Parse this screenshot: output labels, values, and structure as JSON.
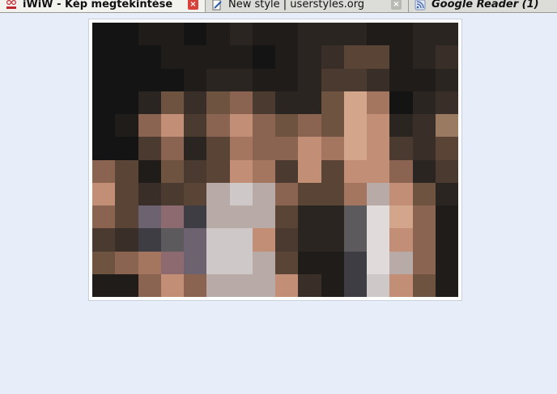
{
  "tabs": [
    {
      "label": "iWiW - Kép megtekintése",
      "icon": "iwiw-logo-icon",
      "active": true
    },
    {
      "label": "New style | userstyles.org",
      "icon": "pencil-page-icon",
      "active": false
    },
    {
      "label": "Google Reader (1)",
      "icon": "rss-feed-icon",
      "active": false
    }
  ],
  "close_symbol": "×",
  "colors": {
    "page_bg": "#e8eef9",
    "close_active": "#d9413b",
    "close_inactive": "#b9b9b4"
  },
  "photo": {
    "palette": [
      "#141414",
      "#1f1c1a",
      "#2b2521",
      "#3a2f28",
      "#4a3a30",
      "#5a4436",
      "#6e5340",
      "#8a6450",
      "#a47660",
      "#c28e76",
      "#d3a58a",
      "#b8aaa6",
      "#cfc8c8",
      "#e0dada",
      "#5d5a5e",
      "#3f3d44",
      "#6d6270",
      "#8c6a70",
      "#241f1f",
      "#9a7a60"
    ],
    "pixels": [
      [
        0,
        0,
        1,
        1,
        0,
        1,
        2,
        1,
        1,
        2,
        2,
        2,
        1,
        1,
        2,
        2
      ],
      [
        0,
        0,
        0,
        1,
        1,
        1,
        1,
        0,
        1,
        2,
        3,
        5,
        5,
        1,
        2,
        3
      ],
      [
        0,
        0,
        0,
        0,
        1,
        2,
        2,
        1,
        1,
        2,
        4,
        4,
        3,
        1,
        1,
        2
      ],
      [
        0,
        0,
        2,
        6,
        3,
        6,
        7,
        4,
        2,
        2,
        6,
        10,
        8,
        0,
        2,
        3
      ],
      [
        0,
        1,
        7,
        9,
        4,
        7,
        9,
        7,
        6,
        7,
        6,
        10,
        9,
        2,
        3,
        19
      ],
      [
        0,
        0,
        4,
        7,
        2,
        5,
        8,
        7,
        7,
        9,
        8,
        10,
        9,
        4,
        3,
        5
      ],
      [
        7,
        5,
        1,
        6,
        4,
        5,
        9,
        8,
        4,
        9,
        5,
        9,
        9,
        7,
        2,
        4
      ],
      [
        9,
        5,
        3,
        4,
        5,
        11,
        12,
        11,
        7,
        5,
        5,
        8,
        11,
        9,
        6,
        2
      ],
      [
        7,
        5,
        16,
        17,
        15,
        11,
        11,
        11,
        5,
        2,
        2,
        14,
        13,
        10,
        7,
        1
      ],
      [
        4,
        3,
        15,
        14,
        16,
        12,
        12,
        9,
        4,
        2,
        2,
        14,
        13,
        9,
        7,
        1
      ],
      [
        6,
        7,
        8,
        17,
        16,
        12,
        12,
        11,
        5,
        1,
        1,
        15,
        13,
        11,
        7,
        1
      ],
      [
        1,
        1,
        7,
        9,
        7,
        11,
        11,
        11,
        9,
        3,
        1,
        15,
        12,
        9,
        6,
        1
      ]
    ]
  }
}
